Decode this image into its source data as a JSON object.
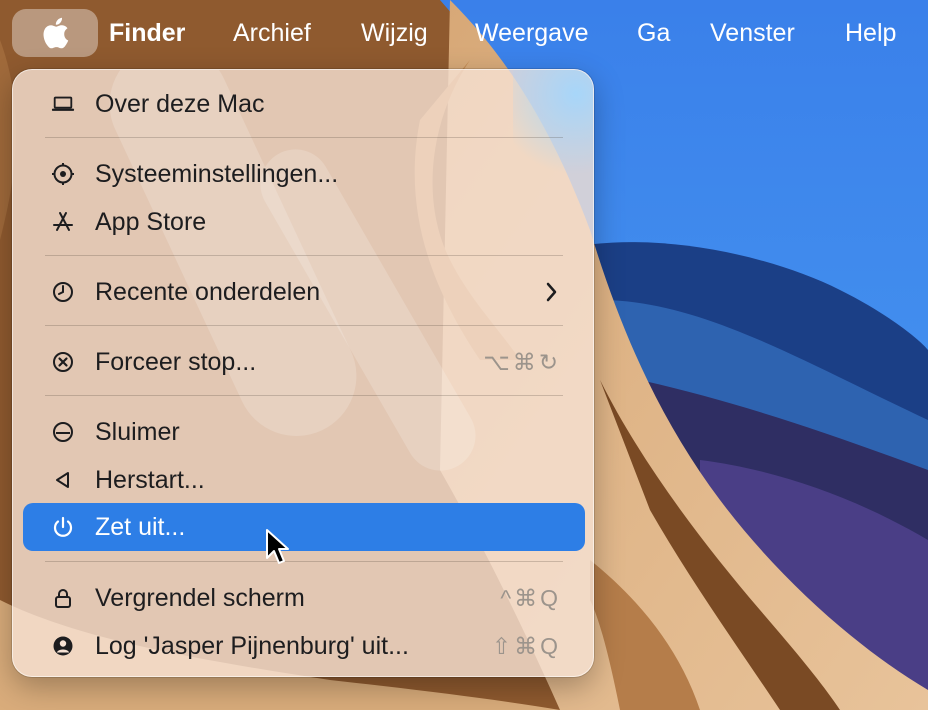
{
  "menubar": {
    "app_name": "Finder",
    "items": [
      "Archief",
      "Wijzig",
      "Weergave",
      "Ga",
      "Venster",
      "Help"
    ]
  },
  "apple_menu": {
    "items": [
      {
        "label": "Over deze Mac",
        "icon": "laptop-icon"
      },
      {
        "label": "Systeeminstellingen...",
        "icon": "gear-icon"
      },
      {
        "label": "App Store",
        "icon": "app-store-icon"
      },
      {
        "label": "Recente onderdelen",
        "icon": "clock-icon",
        "submenu_icon": "chevron-right-icon"
      },
      {
        "label": "Forceer stop...",
        "icon": "force-quit-icon",
        "shortcut": "⌥⌘↻"
      },
      {
        "label": "Sluimer",
        "icon": "sleep-icon"
      },
      {
        "label": "Herstart...",
        "icon": "restart-icon"
      },
      {
        "label": "Zet uit...",
        "icon": "power-icon",
        "highlighted": true
      },
      {
        "label": "Vergrendel scherm",
        "icon": "lock-icon",
        "shortcut": "^⌘Q"
      },
      {
        "label": "Log 'Jasper Pijnenburg' uit...",
        "icon": "user-icon",
        "shortcut": "⇧⌘Q"
      }
    ]
  },
  "colors": {
    "highlight": "#2d7ee6",
    "menu_background": "#f6e2d4",
    "shortcut_text": "#9c948c"
  }
}
